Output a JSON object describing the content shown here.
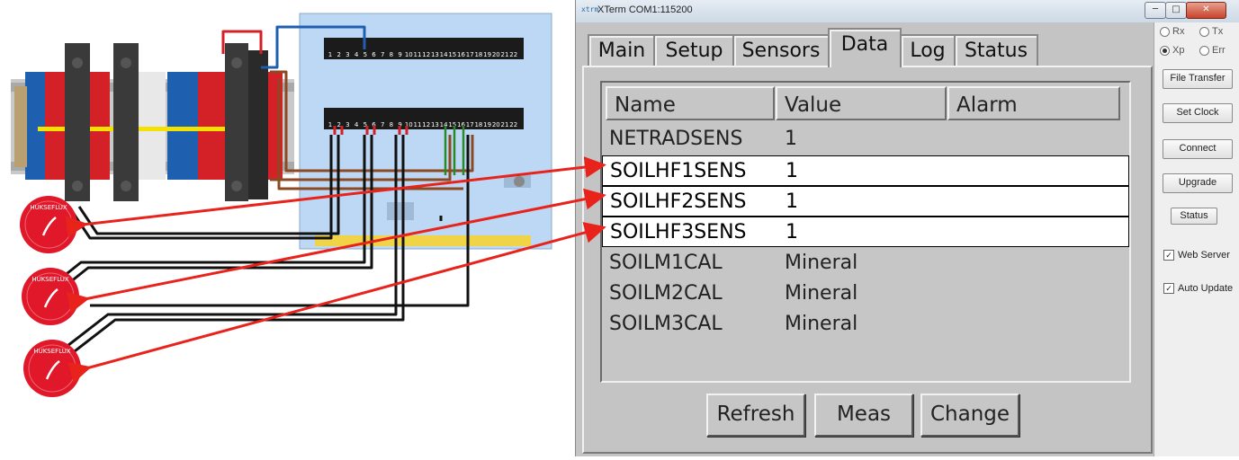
{
  "window": {
    "title": "XTerm COM1:115200",
    "logo_text": "xtrm"
  },
  "window_controls": {
    "minimize": "─",
    "maximize": "□",
    "close": "✕"
  },
  "tabs": [
    "Main",
    "Setup",
    "Sensors",
    "Data",
    "Log",
    "Status"
  ],
  "active_tab": "Data",
  "grid": {
    "columns": [
      "Name",
      "Value",
      "Alarm"
    ],
    "rows": [
      {
        "name": "NETRADSENS",
        "value": "1",
        "selected": false
      },
      {
        "name": "SOILHF1SENS",
        "value": "1",
        "selected": true
      },
      {
        "name": "SOILHF2SENS",
        "value": "1",
        "selected": true
      },
      {
        "name": "SOILHF3SENS",
        "value": "1",
        "selected": true
      },
      {
        "name": "SOILM1CAL",
        "value": "Mineral",
        "selected": false
      },
      {
        "name": "SOILM2CAL",
        "value": "Mineral",
        "selected": false
      },
      {
        "name": "SOILM3CAL",
        "value": "Mineral",
        "selected": false
      }
    ]
  },
  "buttons": {
    "refresh": "Refresh",
    "meas": "Meas",
    "change": "Change"
  },
  "side": {
    "radios": [
      {
        "label": "Rx",
        "on": false
      },
      {
        "label": "Tx",
        "on": false
      },
      {
        "label": "Xp",
        "on": true
      },
      {
        "label": "Err",
        "on": false
      }
    ],
    "buttons": [
      "File Transfer",
      "Set Clock",
      "Connect",
      "Upgrade",
      "Status"
    ],
    "checks": [
      {
        "label": "Web Server",
        "checked": true
      },
      {
        "label": "Auto Update",
        "checked": true
      }
    ]
  },
  "diagram": {
    "board_top_labels": [
      "1",
      "2",
      "3",
      "4",
      "5",
      "6",
      "7",
      "8",
      "9",
      "10",
      "11",
      "12",
      "13",
      "14",
      "15",
      "16",
      "17",
      "18",
      "19",
      "20",
      "21",
      "22"
    ],
    "board_bottom_labels": [
      "1",
      "2",
      "3",
      "4",
      "5",
      "6",
      "7",
      "8",
      "9",
      "10",
      "11",
      "12",
      "13",
      "14",
      "15",
      "16",
      "17",
      "18",
      "19",
      "20",
      "21",
      "22"
    ],
    "sensor_text": "HUKSEFLUX"
  },
  "colors": {
    "arrow": "#e8231c",
    "sensor": "#e0182a",
    "selected_row": "#ffffff",
    "terminal_red": "#d42027",
    "terminal_blue": "#1f5fb0"
  }
}
